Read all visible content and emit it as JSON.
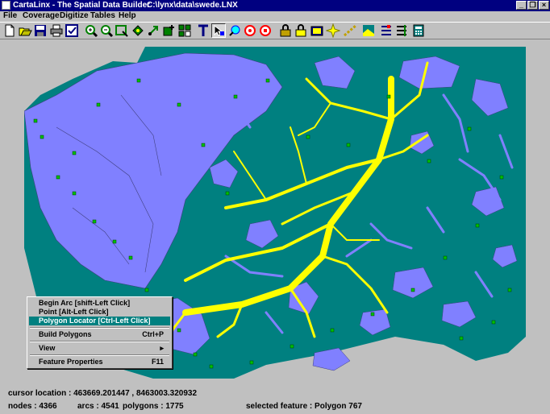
{
  "window": {
    "app_title": "CartaLinx - The Spatial Data Builder",
    "file_path": "C:\\lynx\\data\\swede.LNX"
  },
  "menu": [
    {
      "label": "File"
    },
    {
      "label": "Coverage"
    },
    {
      "label": "Digitize"
    },
    {
      "label": "Tables"
    },
    {
      "label": "Help"
    }
  ],
  "toolbar": {
    "icons": [
      "new-file-icon",
      "open-file-icon",
      "save-icon",
      "print-icon",
      "check-icon",
      "zoom-in-icon",
      "zoom-out-icon",
      "zoom-window-icon",
      "pan-icon",
      "navigate-icon",
      "tool-a-icon",
      "tool-b-icon",
      "text-tool-icon",
      "select-arrow-icon",
      "polygon-locator-icon",
      "target-icon",
      "node-icon",
      "lock-icon",
      "lock-alt-icon",
      "layer-icon",
      "sparkle-icon",
      "arc-icon",
      "layer-view-icon",
      "tables-icon",
      "list-icon",
      "calculator-icon"
    ],
    "pressed_index": 13
  },
  "colors": {
    "land": "#008080",
    "water": "#ffff00",
    "polygon": "#8080ff",
    "node": "#00c000",
    "highlight": "#008080"
  },
  "context_menu": {
    "items": [
      {
        "label": "Begin Arc  [shift-Left Click]",
        "shortcut": ""
      },
      {
        "label": "Point  [Alt-Left Click]",
        "shortcut": ""
      },
      {
        "label": "Polygon Locator  [Ctrl-Left Click]",
        "shortcut": "",
        "highlighted": true
      },
      {
        "label": "Build Polygons",
        "shortcut": "Ctrl+P"
      },
      {
        "label": "View",
        "shortcut": "▸"
      },
      {
        "label": "Feature Properties",
        "shortcut": "F11"
      }
    ]
  },
  "status": {
    "cursor_location": "cursor location : 463669.201447 , 8463003.320932",
    "nodes": "nodes : 4366",
    "arcs": "arcs : 4541",
    "polygons": "polygons : 1775",
    "selected_feature": "selected feature : Polygon 767"
  }
}
